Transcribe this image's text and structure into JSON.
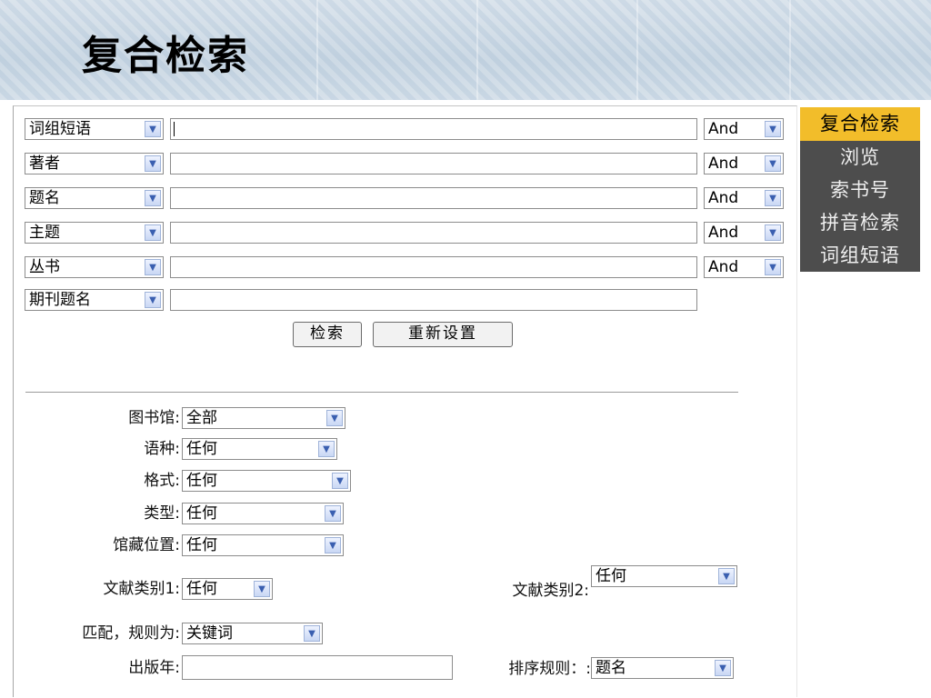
{
  "header": {
    "title": "复合检索"
  },
  "search_rows": [
    {
      "field": "词组短语",
      "bool": "And"
    },
    {
      "field": "著者",
      "bool": "And"
    },
    {
      "field": "题名",
      "bool": "And"
    },
    {
      "field": "主题",
      "bool": "And"
    },
    {
      "field": "丛书",
      "bool": "And"
    },
    {
      "field": "期刊题名"
    }
  ],
  "buttons": {
    "search": "检索",
    "reset": "重新设置"
  },
  "filters": {
    "library": {
      "label": "图书馆:",
      "value": "全部"
    },
    "language": {
      "label": "语种:",
      "value": "任何"
    },
    "format": {
      "label": "格式:",
      "value": "任何"
    },
    "type": {
      "label": "类型:",
      "value": "任何"
    },
    "location": {
      "label": "馆藏位置:",
      "value": "任何"
    },
    "doc_type1": {
      "label": "文献类别1:",
      "value": "任何"
    },
    "doc_type2": {
      "label": "文献类别2:",
      "value": "任何"
    },
    "match": {
      "label": "匹配，规则为:",
      "value": "关键词"
    },
    "pub_year": {
      "label": "出版年:",
      "value": ""
    },
    "sort": {
      "label": "排序规则：:",
      "value": "题名"
    }
  },
  "sidenav": [
    "复合检索",
    "浏览",
    "索书号",
    "拼音检索",
    "词组短语"
  ]
}
